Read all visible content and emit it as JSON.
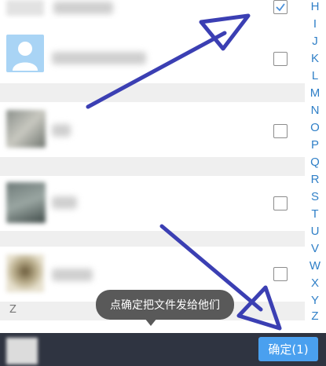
{
  "sections": {
    "z_label": "Z"
  },
  "contacts": [
    {
      "checked": true
    },
    {
      "checked": false
    },
    {
      "checked": false
    },
    {
      "checked": false
    },
    {
      "checked": false
    }
  ],
  "index_letters": [
    "H",
    "I",
    "J",
    "K",
    "L",
    "M",
    "N",
    "O",
    "P",
    "Q",
    "R",
    "S",
    "T",
    "U",
    "V",
    "W",
    "X",
    "Y",
    "Z"
  ],
  "tooltip": {
    "text": "点确定把文件发给他们"
  },
  "bottom_bar": {
    "confirm_label": "确定(1)"
  },
  "colors": {
    "accent": "#4aa0ef",
    "index_letter": "#2f7fc7",
    "bottom_bar": "#2f3441",
    "annotation_arrow": "#3b3fb3"
  }
}
